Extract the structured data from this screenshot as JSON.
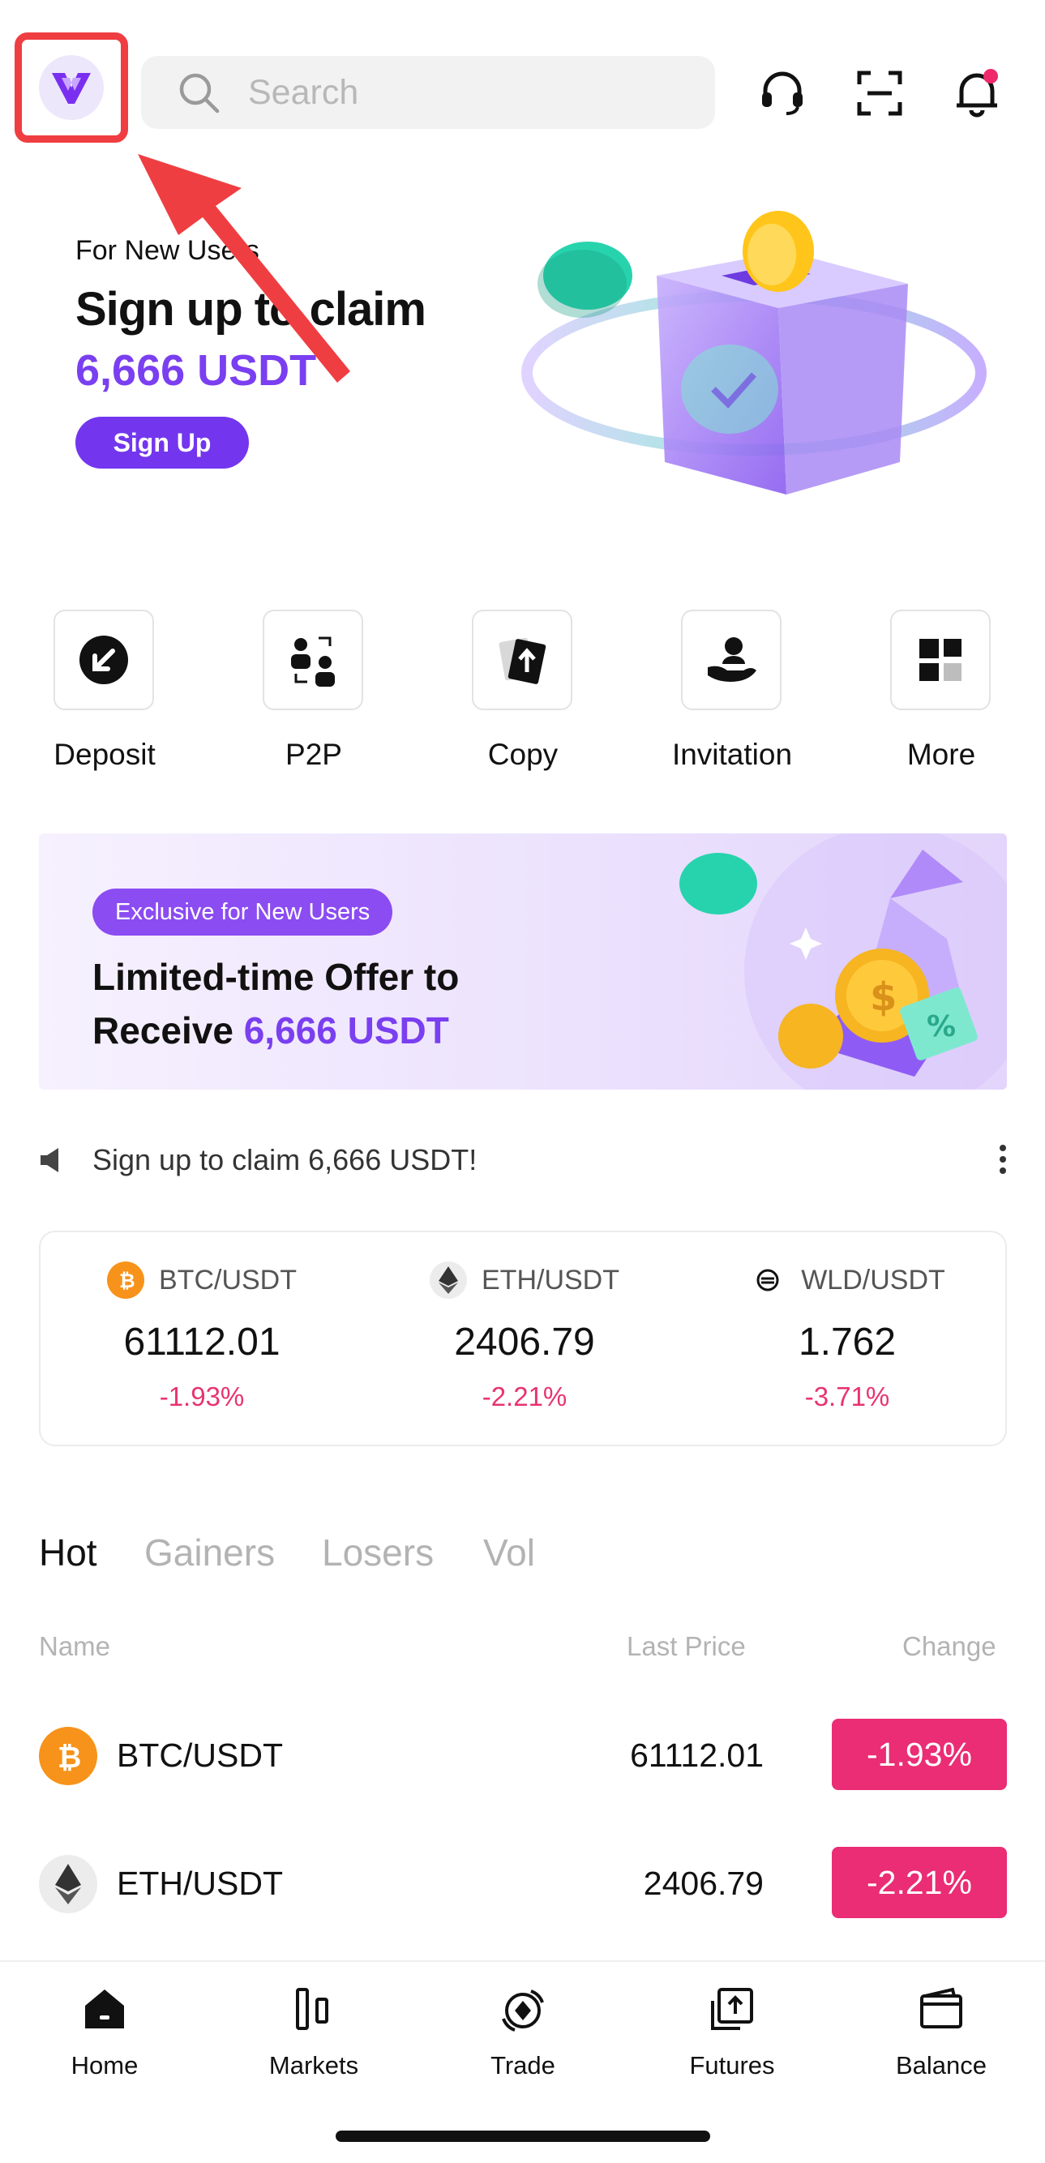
{
  "header": {
    "search_placeholder": "Search",
    "icons": [
      "support-headset-icon",
      "scan-icon",
      "bell-icon"
    ]
  },
  "hero": {
    "small": "For New Users",
    "title": "Sign up to claim",
    "amount": "6,666 USDT",
    "button": "Sign Up"
  },
  "shortcuts": [
    {
      "label": "Deposit",
      "icon": "deposit-icon"
    },
    {
      "label": "P2P",
      "icon": "p2p-icon"
    },
    {
      "label": "Copy",
      "icon": "copy-trade-icon"
    },
    {
      "label": "Invitation",
      "icon": "invitation-icon"
    },
    {
      "label": "More",
      "icon": "more-grid-icon"
    }
  ],
  "promo": {
    "tag": "Exclusive for New Users",
    "line1": "Limited-time Offer to",
    "line2_prefix": "Receive ",
    "line2_amount": "6,666 USDT"
  },
  "ticker": {
    "text": "Sign up to claim 6,666 USDT!"
  },
  "pairs": [
    {
      "pair": "BTC/USDT",
      "price": "61112.01",
      "change": "-1.93%"
    },
    {
      "pair": "ETH/USDT",
      "price": "2406.79",
      "change": "-2.21%"
    },
    {
      "pair": "WLD/USDT",
      "price": "1.762",
      "change": "-3.71%"
    }
  ],
  "market_tabs": [
    "Hot",
    "Gainers",
    "Losers",
    "Vol"
  ],
  "table": {
    "headers": {
      "name": "Name",
      "price": "Last Price",
      "change": "Change"
    },
    "rows": [
      {
        "pair": "BTC/USDT",
        "price": "61112.01",
        "change": "-1.93%"
      },
      {
        "pair": "ETH/USDT",
        "price": "2406.79",
        "change": "-2.21%"
      }
    ]
  },
  "nav": [
    {
      "label": "Home",
      "icon": "home-icon"
    },
    {
      "label": "Markets",
      "icon": "markets-icon"
    },
    {
      "label": "Trade",
      "icon": "trade-icon"
    },
    {
      "label": "Futures",
      "icon": "futures-icon"
    },
    {
      "label": "Balance",
      "icon": "wallet-icon"
    }
  ],
  "colors": {
    "brand_purple": "#7336ee",
    "negative": "#ea2d74",
    "highlight_box": "#ef3e42",
    "btc": "#f7931a"
  }
}
